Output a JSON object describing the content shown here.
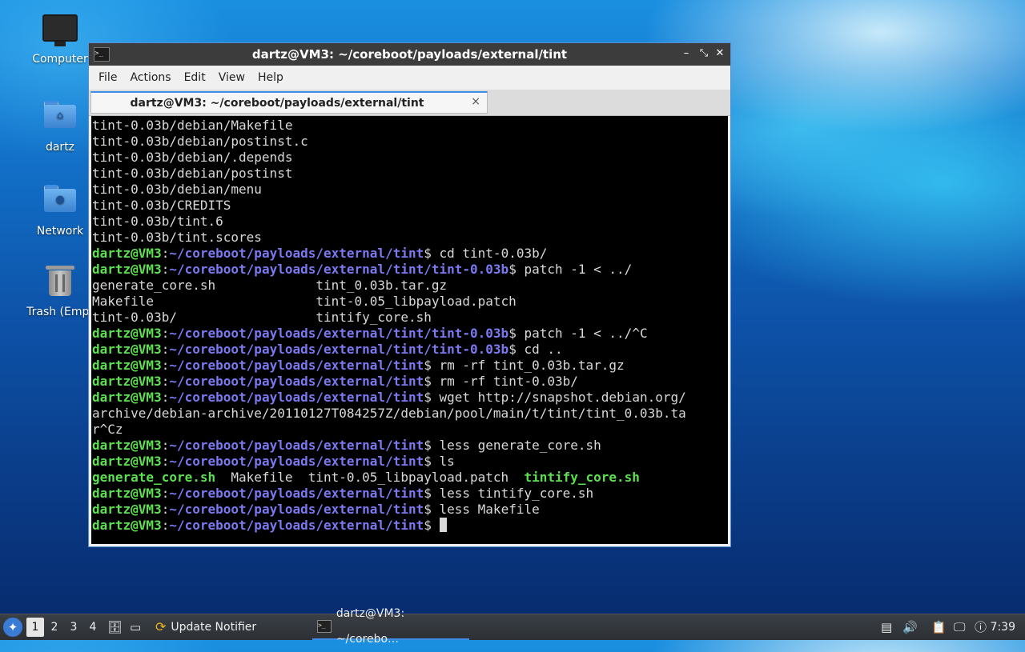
{
  "desktop": {
    "icons": [
      {
        "label": "Computer"
      },
      {
        "label": "dartz"
      },
      {
        "label": "Network"
      },
      {
        "label": "Trash (Empt"
      }
    ]
  },
  "window": {
    "title": "dartz@VM3: ~/coreboot/payloads/external/tint",
    "menu": [
      "File",
      "Actions",
      "Edit",
      "View",
      "Help"
    ],
    "tab_label": "dartz@VM3: ~/coreboot/payloads/external/tint",
    "tab_close": "×"
  },
  "terminal": {
    "user": "dartz@VM3",
    "lines": [
      {
        "t": "tint-0.03b/debian/Makefile"
      },
      {
        "t": "tint-0.03b/debian/postinst.c"
      },
      {
        "t": "tint-0.03b/debian/.depends"
      },
      {
        "t": "tint-0.03b/debian/postinst"
      },
      {
        "t": "tint-0.03b/debian/menu"
      },
      {
        "t": "tint-0.03b/CREDITS"
      },
      {
        "t": "tint-0.03b/tint.6"
      },
      {
        "t": "tint-0.03b/tint.scores"
      },
      {
        "prompt": true,
        "path": "~/coreboot/payloads/external/tint",
        "cmd": "cd tint-0.03b/"
      },
      {
        "prompt": true,
        "path": "~/coreboot/payloads/external/tint/tint-0.03b",
        "cmd": "patch -1 < ../"
      },
      {
        "t": "generate_core.sh             tint_0.03b.tar.gz"
      },
      {
        "t": "Makefile                     tint-0.05_libpayload.patch"
      },
      {
        "t": "tint-0.03b/                  tintify_core.sh"
      },
      {
        "prompt": true,
        "path": "~/coreboot/payloads/external/tint/tint-0.03b",
        "cmd": "patch -1 < ../^C"
      },
      {
        "prompt": true,
        "path": "~/coreboot/payloads/external/tint/tint-0.03b",
        "cmd": "cd .."
      },
      {
        "prompt": true,
        "path": "~/coreboot/payloads/external/tint",
        "cmd": "rm -rf tint_0.03b.tar.gz"
      },
      {
        "prompt": true,
        "path": "~/coreboot/payloads/external/tint",
        "cmd": "rm -rf tint-0.03b/"
      },
      {
        "prompt": true,
        "path": "~/coreboot/payloads/external/tint",
        "cmd": "wget http://snapshot.debian.org/"
      },
      {
        "t": "archive/debian-archive/20110127T084257Z/debian/pool/main/t/tint/tint_0.03b.ta"
      },
      {
        "t": "r^Cz"
      },
      {
        "prompt": true,
        "path": "~/coreboot/payloads/external/tint",
        "cmd": "less generate_core.sh"
      },
      {
        "prompt": true,
        "path": "~/coreboot/payloads/external/tint",
        "cmd": "ls"
      },
      {
        "ls": true,
        "a": "generate_core.sh",
        "b": "  Makefile  tint-0.05_libpayload.patch  ",
        "c": "tintify_core.sh"
      },
      {
        "prompt": true,
        "path": "~/coreboot/payloads/external/tint",
        "cmd": "less tintify_core.sh"
      },
      {
        "prompt": true,
        "path": "~/coreboot/payloads/external/tint",
        "cmd": "less Makefile"
      },
      {
        "prompt": true,
        "path": "~/coreboot/payloads/external/tint",
        "cmd": "",
        "cursor": true
      }
    ]
  },
  "taskbar": {
    "start_glyph": "✦",
    "workspaces": [
      "1",
      "2",
      "3",
      "4"
    ],
    "active_workspace": "1",
    "update_notifier": "Update Notifier",
    "terminal_task": "dartz@VM3: ~/corebo…",
    "clock": "7:39",
    "icons": [
      "files-icon",
      "desktop-icon",
      "update-icon",
      "battery-icon",
      "volume-icon",
      "clipboard-icon",
      "network-icon",
      "notification-icon"
    ]
  }
}
